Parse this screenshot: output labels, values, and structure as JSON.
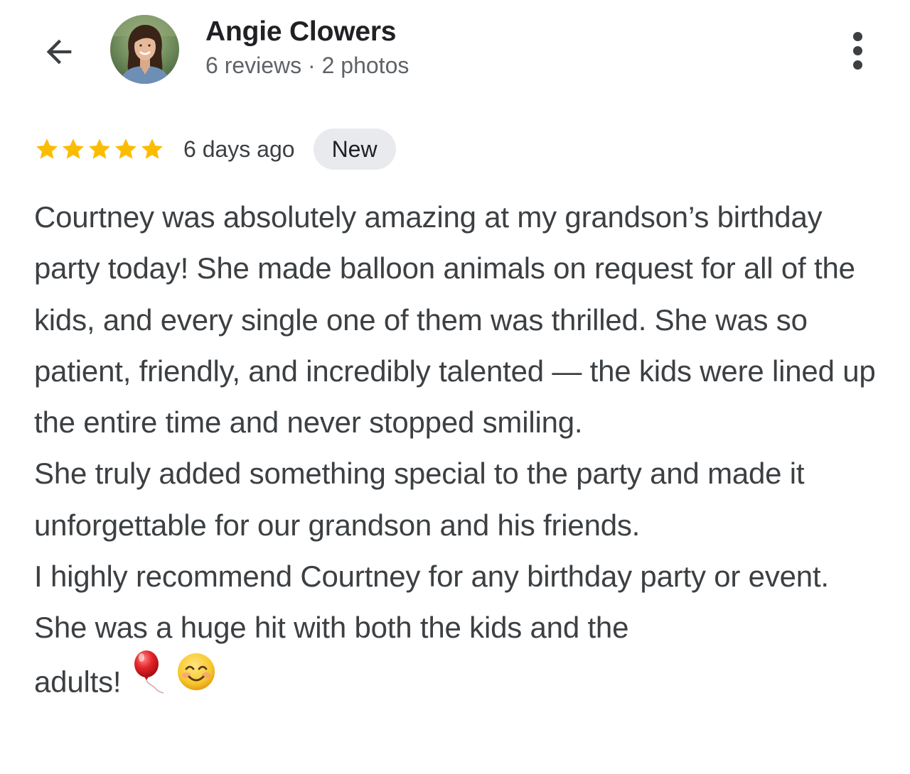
{
  "header": {
    "back_icon": "arrow-left-icon",
    "reviewer_name": "Angie Clowers",
    "reviewer_meta": "6 reviews · 2 photos",
    "menu_icon": "more-vert-icon"
  },
  "review": {
    "rating": 5,
    "rating_max": 5,
    "star_color": "#fbbc04",
    "date": "6 days ago",
    "badge": "New",
    "paragraphs": [
      "Courtney was absolutely amazing at my grandson’s birthday party today! She made balloon animals on request for all of the kids, and every single one of them was thrilled. She was so patient, friendly, and incredibly talented — the kids were lined up the entire time and never stopped smiling.",
      "She truly added something special to the party and made it unforgettable for our grandson and his friends.",
      "I highly recommend Courtney for any birthday party or event. She was a huge hit with both the kids and the"
    ],
    "last_line_text": "adults!",
    "trailing_emojis": [
      "balloon-icon",
      "smiling-face-icon"
    ]
  }
}
